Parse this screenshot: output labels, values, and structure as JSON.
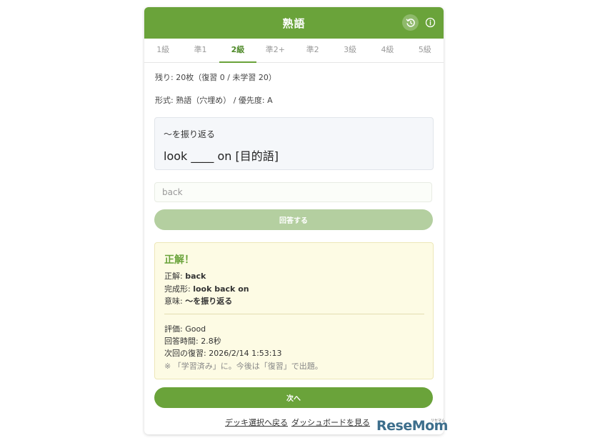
{
  "header": {
    "title": "熟語"
  },
  "tabs": [
    {
      "label": "1級",
      "active": false
    },
    {
      "label": "準1",
      "active": false
    },
    {
      "label": "2級",
      "active": true
    },
    {
      "label": "準2+",
      "active": false
    },
    {
      "label": "準2",
      "active": false
    },
    {
      "label": "3級",
      "active": false
    },
    {
      "label": "4級",
      "active": false
    },
    {
      "label": "5級",
      "active": false
    }
  ],
  "status": {
    "remaining": "残り: 20枚（復習 0 / 未学習 20）",
    "format": "形式: 熟語（穴埋め） / 優先度: A"
  },
  "question": {
    "prompt": "～を振り返る",
    "text": "look ____ on [目的語]"
  },
  "answer": {
    "value": "back",
    "submit_label": "回答する"
  },
  "result": {
    "title": "正解！",
    "correct_label": "正解: ",
    "correct_value": "back",
    "complete_label": "完成形: ",
    "complete_value": "look back on",
    "meaning_label": "意味: ",
    "meaning_value": "～を振り返る",
    "rating": "評価: Good",
    "time": "回答時間: 2.8秒",
    "next_review": "次回の復習: 2026/2/14 1:53:13",
    "note": "※ 「学習済み」に。今後は「復習」で出題。"
  },
  "next_label": "次へ",
  "footer": {
    "back_to_deck": "デッキ選択へ戻る",
    "dashboard": "ダッシュボードを見る"
  },
  "watermark": {
    "logo": "ReseMom",
    "ruby": "リセマム"
  },
  "colors": {
    "accent": "#6aa33a",
    "result_bg": "#fdfbe4",
    "submit_disabled": "#b4cfa0"
  }
}
